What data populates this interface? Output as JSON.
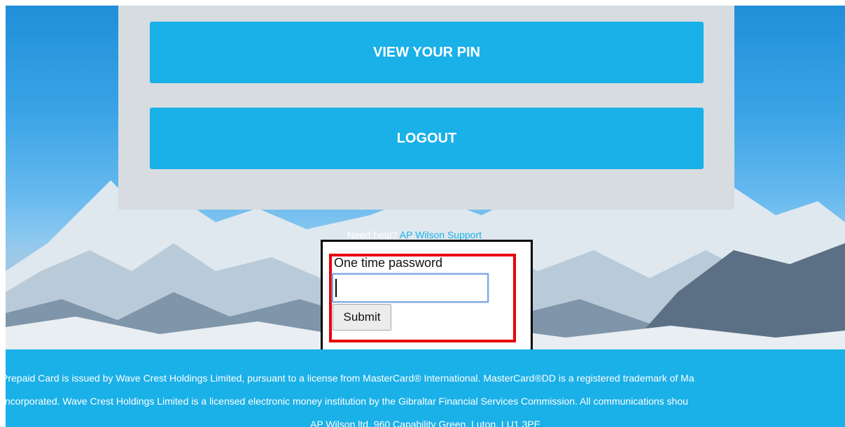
{
  "panel": {
    "view_pin_label": "VIEW YOUR PIN",
    "logout_label": "LOGOUT"
  },
  "help": {
    "text": "Need help?",
    "link": "AP Wilson Support"
  },
  "otp": {
    "label": "One time password",
    "value": "",
    "placeholder": "",
    "submit_label": "Submit"
  },
  "footer": {
    "line1": "Prepaid Card is issued by Wave Crest Holdings Limited, pursuant to a license from MasterCard® International. MasterCard®DD is a registered trademark of Ma",
    "line2": "l Incorporated. Wave Crest Holdings Limited is a licensed electronic money institution by the Gibraltar Financial Services Commission. All communications shou",
    "line3": "AP Wilson ltd, 960 Capability Green, Luton, LU1 3PE"
  },
  "colors": {
    "accent": "#1ab0e8",
    "panel_bg": "#d7dce1",
    "highlight_border": "#e8000b"
  }
}
